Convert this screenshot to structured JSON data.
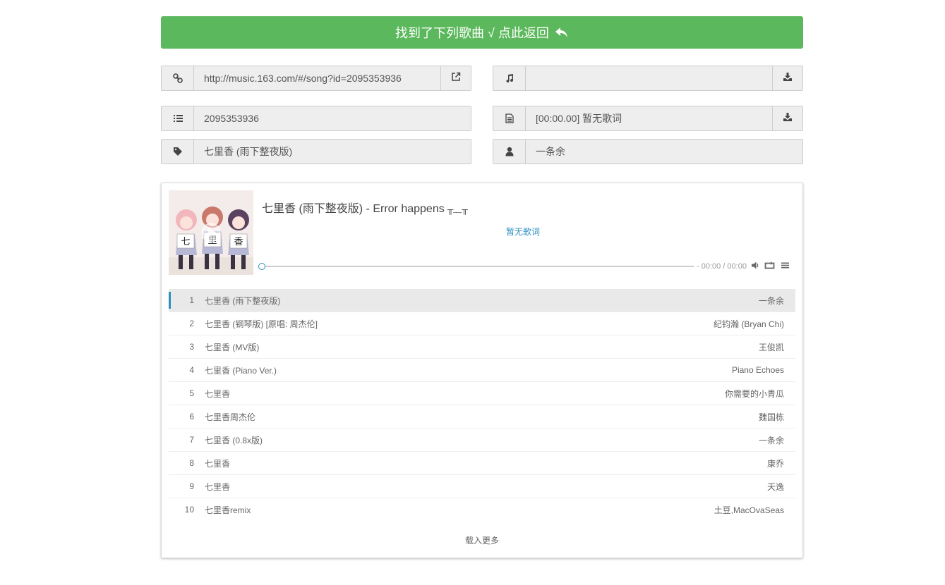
{
  "banner": {
    "text": "找到了下列歌曲 √ 点此返回"
  },
  "fields": {
    "url": {
      "value": "http://music.163.com/#/song?id=2095353936",
      "icon": "link-icon",
      "action_icon": "external-link-icon"
    },
    "audio": {
      "value": "",
      "icon": "music-icon",
      "action_icon": "download-icon"
    },
    "song_id": {
      "value": "2095353936",
      "icon": "list-ol-icon"
    },
    "lyric": {
      "value": "[00:00.00] 暂无歌词",
      "icon": "file-text-icon",
      "action_icon": "download-icon"
    },
    "title": {
      "value": "七里香 (雨下整夜版)",
      "icon": "tag-icon"
    },
    "artist": {
      "value": "一条余",
      "icon": "user-icon"
    }
  },
  "player": {
    "title": "七里香 (雨下整夜版)",
    "separator": " - ",
    "error": "Error happens",
    "face": "╥﹏╥",
    "lyric": "暂无歌词",
    "time": "- 00:00 / 00:00",
    "progress": 0,
    "accent": "#2b8fc1"
  },
  "playlist": [
    {
      "num": "1",
      "name": "七里香 (雨下整夜版)",
      "artist": "一条余"
    },
    {
      "num": "2",
      "name": "七里香 (钢琴版) [原唱: 周杰伦]",
      "artist": "纪钧瀚 (Bryan Chi)"
    },
    {
      "num": "3",
      "name": "七里香 (MV版)",
      "artist": "王俊凯"
    },
    {
      "num": "4",
      "name": "七里香 (Piano Ver.)",
      "artist": "Piano Echoes"
    },
    {
      "num": "5",
      "name": "七里香",
      "artist": "你需要的小青瓜"
    },
    {
      "num": "6",
      "name": "七里香周杰伦",
      "artist": "魏国栋"
    },
    {
      "num": "7",
      "name": "七里香 (0.8x版)",
      "artist": "一条余"
    },
    {
      "num": "8",
      "name": "七里香",
      "artist": "康乔"
    },
    {
      "num": "9",
      "name": "七里香",
      "artist": "天逸"
    },
    {
      "num": "10",
      "name": "七里香remix",
      "artist": "土豆,MacOvaSeas"
    }
  ],
  "load_more": "载入更多",
  "cover_chars": [
    "七",
    "里",
    "香"
  ],
  "colors": {
    "banner": "#5cb85c",
    "field_bg": "#eeeeee"
  }
}
